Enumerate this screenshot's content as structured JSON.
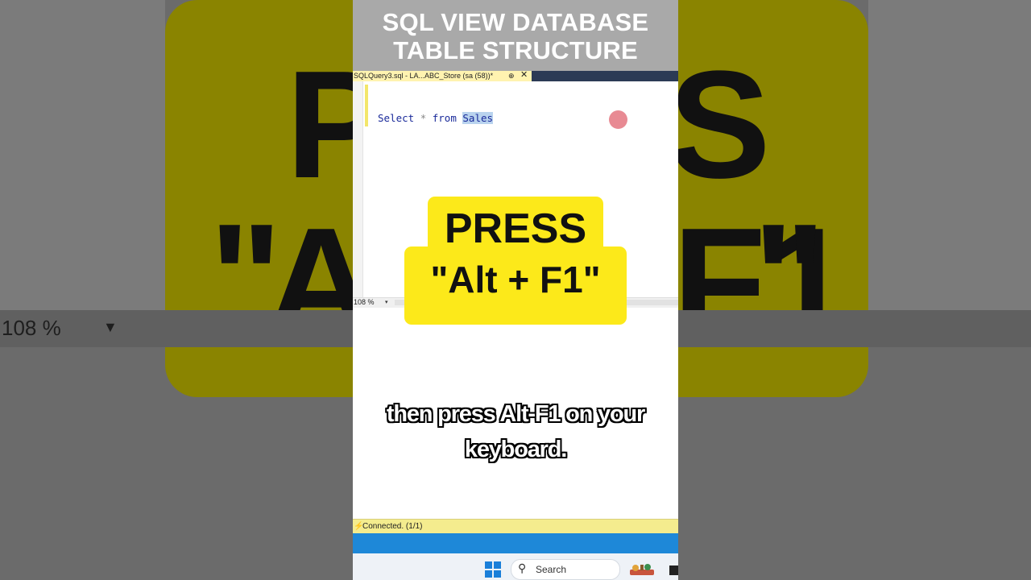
{
  "background": {
    "zoom_text": "108 %",
    "big_letters": [
      "P",
      "S",
      "\"",
      "A",
      "F1",
      "\""
    ]
  },
  "title": {
    "line1": "SQL VIEW DATABASE",
    "line2": "TABLE STRUCTURE"
  },
  "tab": {
    "label": "SQLQuery3.sql - LA...ABC_Store (sa (58))*",
    "pin_icon": "pin-icon",
    "close_glyph": "✕"
  },
  "editor": {
    "keyword_select": "Select",
    "operator": "*",
    "keyword_from": "from",
    "table_name": "Sales"
  },
  "zoom": {
    "value": "108 %",
    "caret": "▾"
  },
  "overlay": {
    "line1": "PRESS",
    "line2": "\"Alt + F1\""
  },
  "caption": {
    "line1": "then press Alt-F1 on your",
    "line2": "keyboard."
  },
  "status": {
    "icon": "connection-icon",
    "text": "Connected. (1/1)"
  },
  "taskbar": {
    "search_label": "Search"
  },
  "colors": {
    "highlight_yellow": "#fce91a",
    "tab_active": "#fff3b0",
    "status_yellow": "#f4ec8e",
    "accent_blue": "#1e88d8",
    "keyword_blue": "#1a2a9a"
  }
}
